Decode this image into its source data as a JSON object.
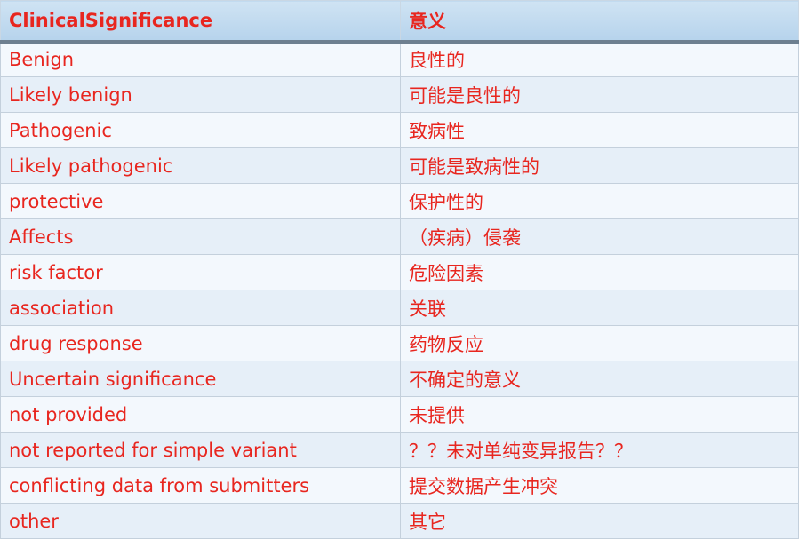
{
  "table": {
    "headers": [
      "ClinicalSignificance",
      "意义"
    ],
    "rows": [
      [
        "Benign",
        "良性的"
      ],
      [
        "Likely benign",
        "可能是良性的"
      ],
      [
        "Pathogenic",
        "致病性"
      ],
      [
        "Likely pathogenic",
        "可能是致病性的"
      ],
      [
        "protective",
        "保护性的"
      ],
      [
        "Affects",
        "（疾病）侵袭"
      ],
      [
        "risk factor",
        "危险因素"
      ],
      [
        "association",
        "关联"
      ],
      [
        "drug response",
        "药物反应"
      ],
      [
        "Uncertain significance",
        "不确定的意义"
      ],
      [
        "not provided",
        "未提供"
      ],
      [
        "not reported for simple variant",
        "？？未对单纯变异报告？？"
      ],
      [
        "conflicting data from submitters",
        "提交数据产生冲突"
      ],
      [
        "other",
        "其它"
      ]
    ]
  },
  "colors": {
    "text": "#e8261f",
    "header_bg": "#c3dbef",
    "row_odd": "#f3f8fd",
    "row_even": "#e6eff8",
    "header_rule": "#6d7f90"
  }
}
